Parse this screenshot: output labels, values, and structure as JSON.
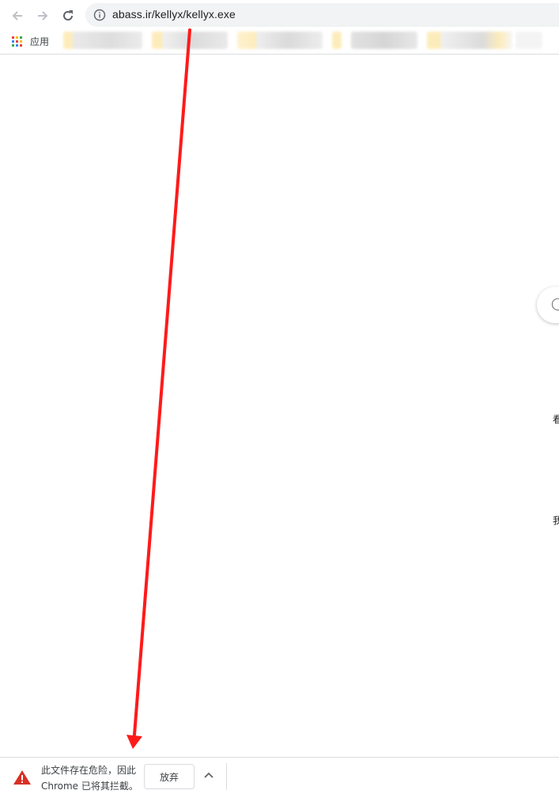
{
  "browser": {
    "url": "abass.ir/kellyx/kellyx.exe"
  },
  "bookmarks_bar": {
    "apps_label": "应用"
  },
  "page": {
    "side_chars": [
      "看",
      "我"
    ]
  },
  "download_bar": {
    "warning_line1": "此文件存在危险，因此",
    "warning_line2": "Chrome 已将其拦截。",
    "discard_label": "放弃"
  },
  "colors": {
    "annotation_arrow": "#ff1a1a",
    "warning_icon": "#d93025",
    "omnibox_bg": "#f1f3f4"
  }
}
